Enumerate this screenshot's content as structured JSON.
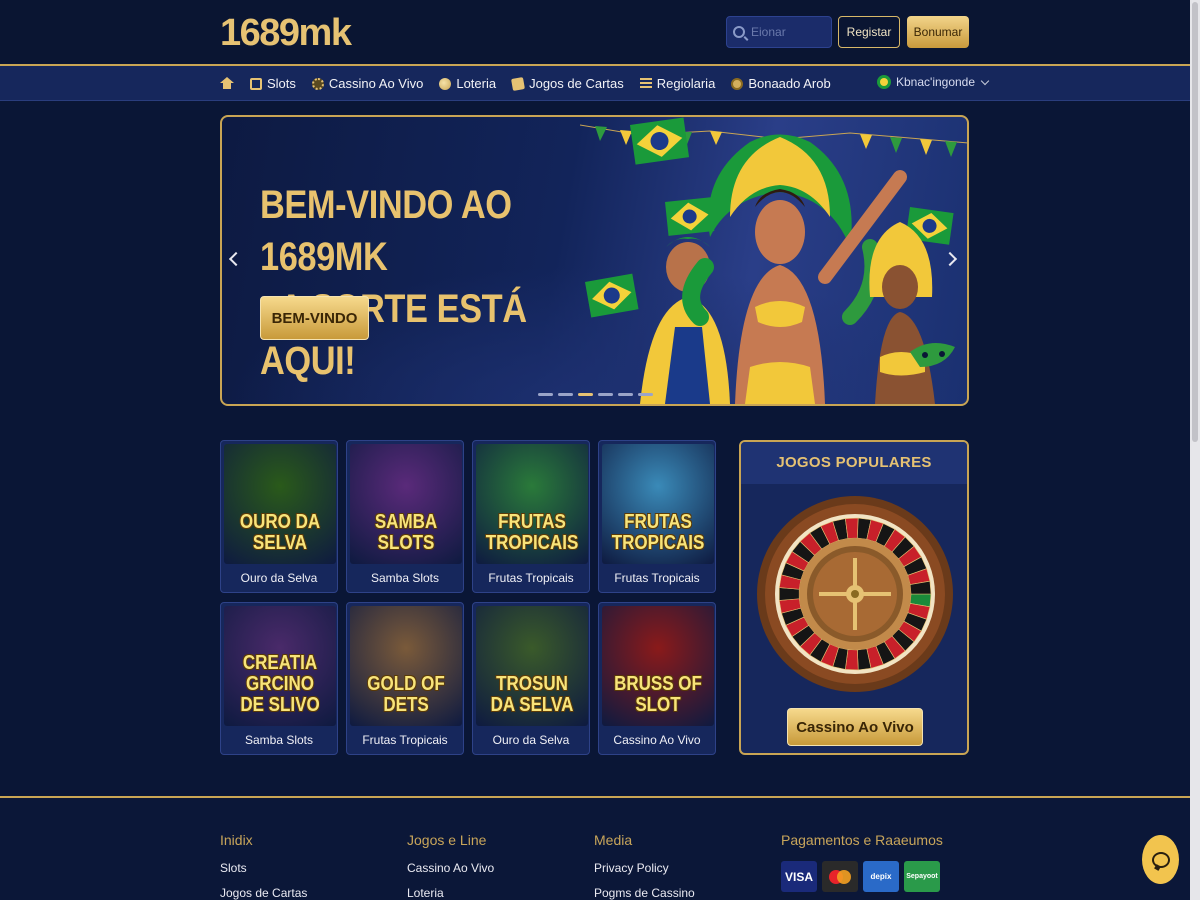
{
  "header": {
    "logo": "1689mk",
    "search_placeholder": "Eionar",
    "register_label": "Registar",
    "bonus_label": "Bonumar"
  },
  "nav": {
    "items": [
      {
        "label": "",
        "icon": "home-icon"
      },
      {
        "label": "Slots",
        "icon": "slot-machine-icon"
      },
      {
        "label": "Cassino Ao Vivo",
        "icon": "chip-icon"
      },
      {
        "label": "Loteria",
        "icon": "lottery-ball-icon"
      },
      {
        "label": "Jogos de Cartas",
        "icon": "cards-icon"
      },
      {
        "label": "Regiolaria",
        "icon": "list-icon"
      },
      {
        "label": "Bonaado Arob",
        "icon": "coin-icon"
      }
    ],
    "language": "Kbnac'ingonde"
  },
  "hero": {
    "title_line1": "BEM-VINDO AO 1689MK",
    "title_line2": "- A SORTE ESTÁ AQUI!",
    "cta_label": "BEM-VINDO",
    "slide_count": 6,
    "active_slide": 3
  },
  "games": [
    {
      "thumb_title": "OURO DA SELVA",
      "label": "Ouro da Selva",
      "bg": "#2a5a1a"
    },
    {
      "thumb_title": "SAMBA SLOTS",
      "label": "Samba Slots",
      "bg": "#5a2a7a"
    },
    {
      "thumb_title": "FRUTAS TROPICAIS",
      "label": "Frutas Tropicais",
      "bg": "#2a7a3a"
    },
    {
      "thumb_title": "FRUTAS TROPICAIS",
      "label": "Frutas Tropicais",
      "bg": "#3a8ab8"
    },
    {
      "thumb_title": "CREATIA GRCINO DE SLIVO",
      "label": "Samba Slots",
      "bg": "#4a2a6a"
    },
    {
      "thumb_title": "GOLD OF DETS",
      "label": "Frutas Tropicais",
      "bg": "#7a5a3a"
    },
    {
      "thumb_title": "TROSUN DA SELVA",
      "label": "Ouro da Selva",
      "bg": "#3a5a2a"
    },
    {
      "thumb_title": "BRUSS OF SLOT",
      "label": "Cassino Ao Vivo",
      "bg": "#8a1a1a"
    }
  ],
  "popular": {
    "title": "JOGOS POPULARES",
    "cta_label": "Cassino Ao Vivo"
  },
  "footer": {
    "col1": {
      "title": "Inidix",
      "links": [
        "Slots",
        "Jogos de Cartas"
      ]
    },
    "col2": {
      "title": "Jogos e Line",
      "links": [
        "Cassino Ao Vivo",
        "Loteria"
      ]
    },
    "col3": {
      "title": "Media",
      "links": [
        "Privacy Policy",
        "Pogms de Cassino"
      ]
    },
    "col4": {
      "title": "Pagamentos e Raaeumos",
      "payments": [
        "VISA",
        "mastercard",
        "depix",
        "Sepayoot"
      ]
    }
  },
  "colors": {
    "gold": "#e6c273",
    "navy": "#0a1636",
    "nav_bg": "#16275c"
  }
}
